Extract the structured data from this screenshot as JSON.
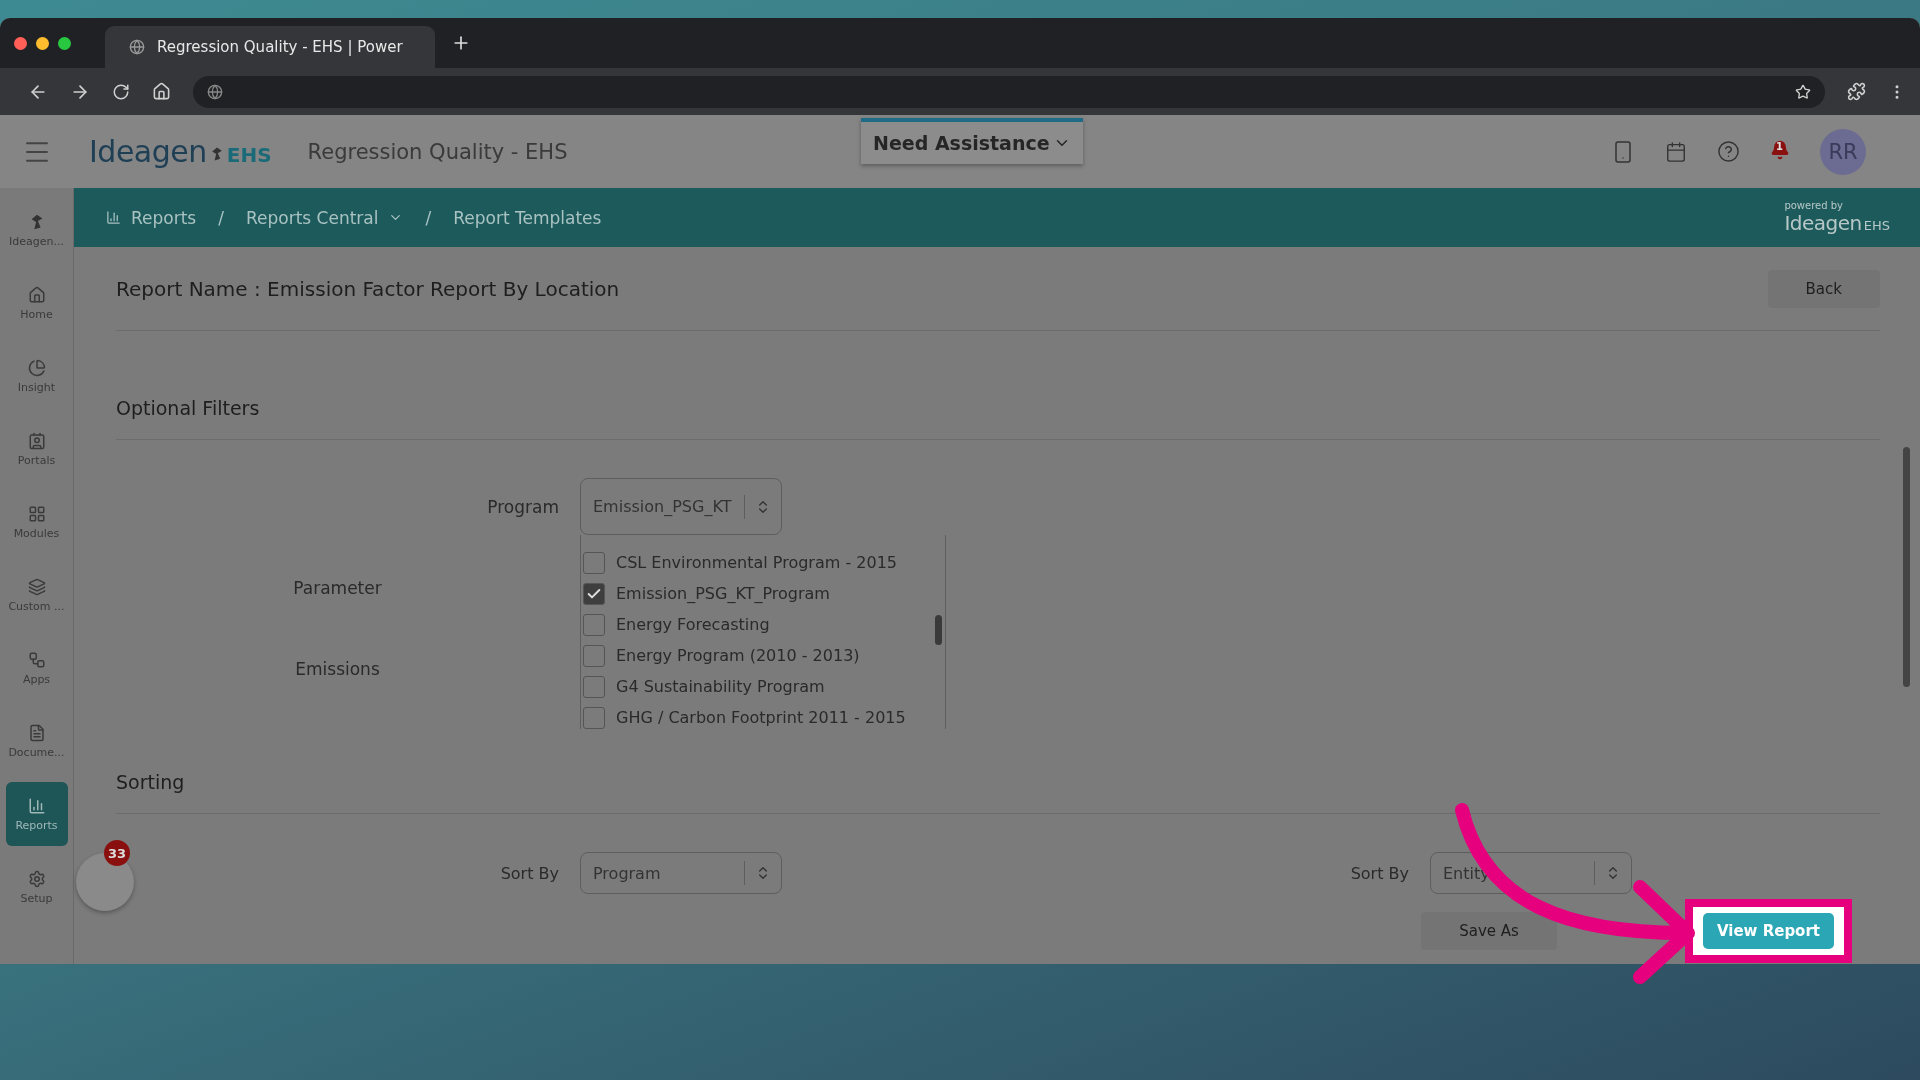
{
  "browser": {
    "tab_title": "Regression Quality - EHS | Power"
  },
  "header": {
    "logo": "Ideagen",
    "logo_suffix": "EHS",
    "app_title": "Regression Quality - EHS",
    "assistance": "Need Assistance",
    "notification_count": "1",
    "avatar": "RR"
  },
  "sidebar": {
    "items": [
      {
        "label": "Ideagen...",
        "selected": false
      },
      {
        "label": "Home",
        "selected": false
      },
      {
        "label": "Insight",
        "selected": false
      },
      {
        "label": "Portals",
        "selected": false
      },
      {
        "label": "Modules",
        "selected": false
      },
      {
        "label": "Custom ...",
        "selected": false
      },
      {
        "label": "Apps",
        "selected": false
      },
      {
        "label": "Docume...",
        "selected": false
      },
      {
        "label": "Reports",
        "selected": true
      },
      {
        "label": "Setup",
        "selected": false
      }
    ]
  },
  "breadcrumbs": [
    {
      "label": "Reports"
    },
    {
      "separator": "/",
      "label": "Reports Central"
    },
    {
      "separator": "/",
      "label": "Report Templates"
    }
  ],
  "powered_by": {
    "caption": "powered by",
    "logo": "Ideagen",
    "logo_suffix": "EHS"
  },
  "report": {
    "title": "Report Name : Emission Factor Report By Location",
    "back": "Back"
  },
  "optional_filters": {
    "heading": "Optional Filters",
    "program_label": "Program",
    "program_value": "Emission_PSG_KT",
    "labels": [
      "Parameter",
      "Emissions"
    ],
    "options": [
      {
        "label": "CSL Environmental Program - 2015",
        "checked": false
      },
      {
        "label": "Emission_PSG_KT_Program",
        "checked": true
      },
      {
        "label": "Energy Forecasting",
        "checked": false
      },
      {
        "label": "Energy Program (2010 - 2013)",
        "checked": false
      },
      {
        "label": "G4 Sustainability Program",
        "checked": false
      },
      {
        "label": "GHG / Carbon Footprint 2011 - 2015",
        "checked": false
      }
    ]
  },
  "sorting": {
    "heading": "Sorting",
    "fields": [
      {
        "label": "Sort By",
        "value": "Program"
      },
      {
        "label": "Sort By",
        "value": "Entity"
      }
    ]
  },
  "actions": {
    "save_as": "Save As",
    "view_report": "View Report"
  },
  "chat": {
    "badge": "33"
  }
}
